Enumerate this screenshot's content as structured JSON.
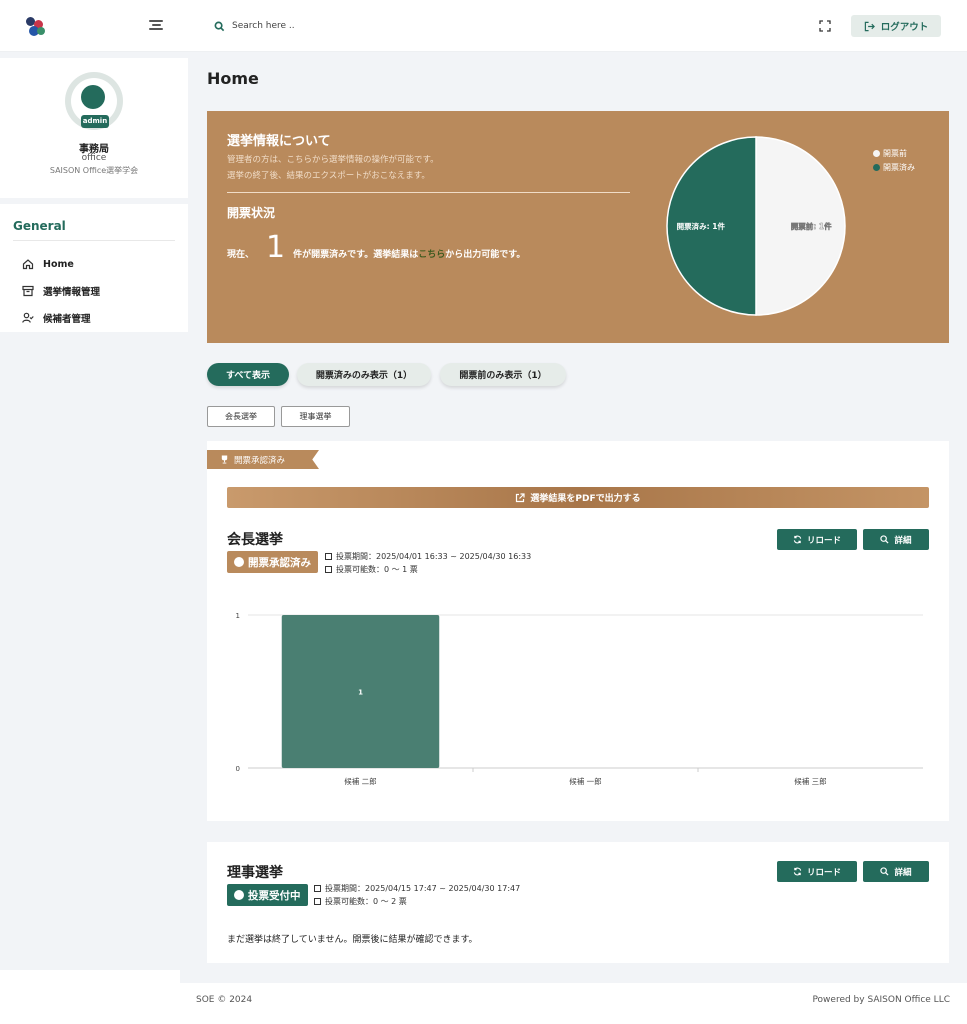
{
  "sidebar": {
    "profile": {
      "badge": "admin",
      "name": "事務局",
      "role": "office",
      "org": "SAISON Office選挙学会"
    },
    "nav_heading": "General",
    "items": [
      {
        "label": "Home",
        "icon": "home-icon"
      },
      {
        "label": "選挙情報管理",
        "icon": "archive-icon"
      },
      {
        "label": "候補者管理",
        "icon": "user-check-icon"
      }
    ]
  },
  "header": {
    "search_placeholder": "Search here ..",
    "logout_label": "ログアウト"
  },
  "page": {
    "title": "Home"
  },
  "info": {
    "heading": "選挙情報について",
    "desc1": "管理者の方は、こちらから選挙情報の操作が可能です。",
    "desc2": "選挙の終了後、結果のエクスポートがおこなえます。",
    "status_heading": "開票状況",
    "status_prefix": "現在、",
    "count": "1",
    "status_mid": "件が開票済みです。選挙結果は",
    "status_link": "こちら",
    "status_suffix": "から出力可能です。",
    "pie": {
      "slices": [
        {
          "label": "開票前",
          "value": 1,
          "color": "#f5f5f5",
          "text": "開票前: 1件"
        },
        {
          "label": "開票済み",
          "value": 1,
          "color": "#246b5c",
          "text": "開票済み: 1件"
        }
      ]
    }
  },
  "filters": {
    "all": "すべて表示",
    "opened_only": "開票済みのみ表示（1）",
    "unopened_only": "開票前のみ表示（1）"
  },
  "tags": [
    "会長選挙",
    "理事選挙"
  ],
  "card1": {
    "ribbon": "開票承認済み",
    "pdf_label": "選挙結果をPDFで出力する",
    "title": "会長選挙",
    "badge": "開票承認済み",
    "period": "投票期間：2025/04/01 16:33 ~ 2025/04/30 16:33",
    "votes": "投票可能数：0 〜 1 票",
    "reload_label": "リロード",
    "detail_label": "詳細"
  },
  "card2": {
    "title": "理事選挙",
    "badge": "投票受付中",
    "period": "投票期間：2025/04/15 17:47 ~ 2025/04/30 17:47",
    "votes": "投票可能数：0 〜 2 票",
    "reload_label": "リロード",
    "detail_label": "詳細",
    "message": "まだ選挙は終了していません。開票後に結果が確認できます。"
  },
  "chart_data": {
    "type": "bar",
    "categories": [
      "候補 二郎",
      "候補 一郎",
      "候補 三郎"
    ],
    "values": [
      1,
      0,
      0
    ],
    "data_labels": [
      "1",
      "",
      ""
    ],
    "title": "",
    "xlabel": "",
    "ylabel": "",
    "ylim": [
      0,
      1
    ],
    "yticks": [
      "0",
      "1"
    ],
    "color": "#4a7f72",
    "grid": true
  },
  "footer": {
    "left": "SOE © 2024",
    "right": "Powered by SAISON Office LLC"
  },
  "colors": {
    "primary": "#246b5c",
    "accent": "#b98a5c",
    "background": "#f2f4f7"
  }
}
